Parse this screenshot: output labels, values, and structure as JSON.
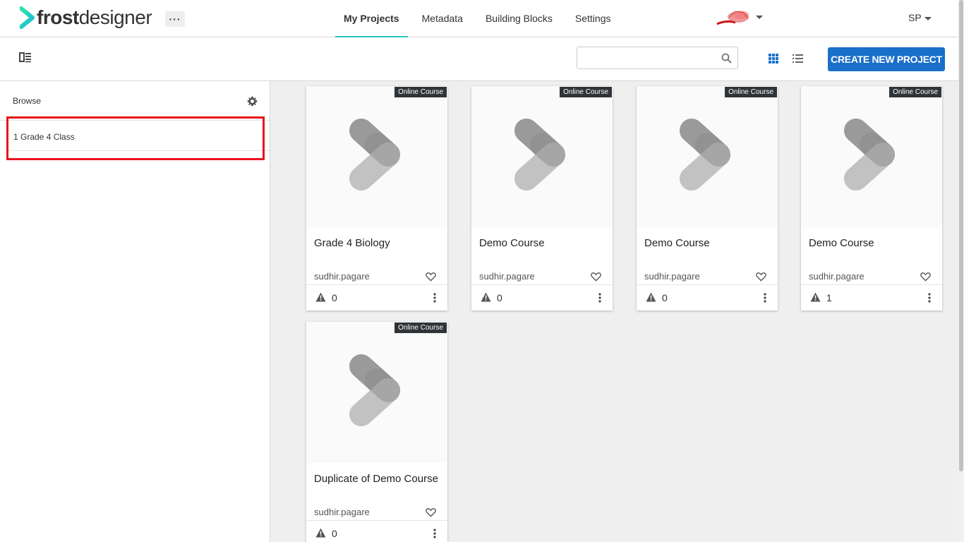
{
  "app": {
    "logo_bold": "frost",
    "logo_light": "designer",
    "more_label": "···"
  },
  "nav": {
    "items": [
      {
        "label": "My Projects",
        "active": true
      },
      {
        "label": "Metadata",
        "active": false
      },
      {
        "label": "Building Blocks",
        "active": false
      },
      {
        "label": "Settings",
        "active": false
      }
    ]
  },
  "user": {
    "initials": "SP"
  },
  "toolbar": {
    "search_value": "",
    "search_placeholder": "",
    "create_label": "CREATE NEW PROJECT"
  },
  "sidebar": {
    "title": "Browse",
    "folders": [
      {
        "label": "1 Grade 4 Class"
      }
    ]
  },
  "projects": [
    {
      "badge": "Online Course",
      "title": "Grade 4 Biology",
      "author": "sudhir.pagare",
      "warnings": "0"
    },
    {
      "badge": "Online Course",
      "title": "Demo Course",
      "author": "sudhir.pagare",
      "warnings": "0"
    },
    {
      "badge": "Online Course",
      "title": "Demo Course",
      "author": "sudhir.pagare",
      "warnings": "0"
    },
    {
      "badge": "Online Course",
      "title": "Demo Course",
      "author": "sudhir.pagare",
      "warnings": "1"
    },
    {
      "badge": "Online Course",
      "title": "Duplicate of Demo Course",
      "author": "sudhir.pagare",
      "warnings": "0"
    }
  ],
  "colors": {
    "accent": "#26c6c6",
    "primary_button": "#1a6fc9",
    "highlight": "#e8141c",
    "badge_bg": "#2f3438"
  },
  "icons": {
    "logo": "chevron-logo-icon",
    "panel_toggle": "panel-toggle-icon",
    "search": "search-icon",
    "grid": "grid-view-icon",
    "list": "list-view-icon",
    "gear": "gear-icon",
    "heart": "heart-icon",
    "warning": "warning-icon",
    "kebab": "kebab-icon"
  }
}
